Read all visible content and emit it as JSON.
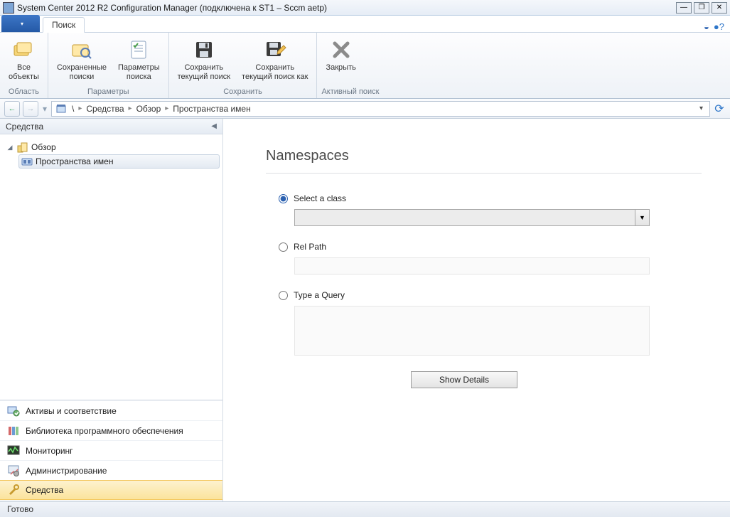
{
  "window": {
    "title": "System Center 2012 R2 Configuration Manager (подключена к ST1 – Sccm aetp)"
  },
  "tabs": {
    "search": "Поиск"
  },
  "ribbon": {
    "groups": {
      "scope": {
        "label": "Область",
        "all_objects": "Все\nобъекты"
      },
      "params": {
        "label": "Параметры",
        "saved_searches": "Сохраненные\nпоиски",
        "search_params": "Параметры\nпоиска"
      },
      "save": {
        "label": "Сохранить",
        "save_current": "Сохранить\nтекущий поиск",
        "save_as": "Сохранить\nтекущий поиск как"
      },
      "active": {
        "label": "Активный поиск",
        "close": "Закрыть"
      }
    }
  },
  "breadcrumb": {
    "root": "Средства",
    "seg2": "Обзор",
    "seg3": "Пространства имен"
  },
  "sidebar": {
    "header": "Средства",
    "tree": {
      "overview": "Обзор",
      "namespaces": "Пространства имен"
    },
    "wunderbar": {
      "assets": "Активы и соответствие",
      "software": "Библиотека программного обеспечения",
      "monitoring": "Мониторинг",
      "admin": "Администрирование",
      "tools": "Средства"
    }
  },
  "content": {
    "heading": "Namespaces",
    "radio_class": "Select a class",
    "radio_relpath": "Rel Path",
    "radio_query": "Type a Query",
    "show_details": "Show Details"
  },
  "status": "Готово"
}
